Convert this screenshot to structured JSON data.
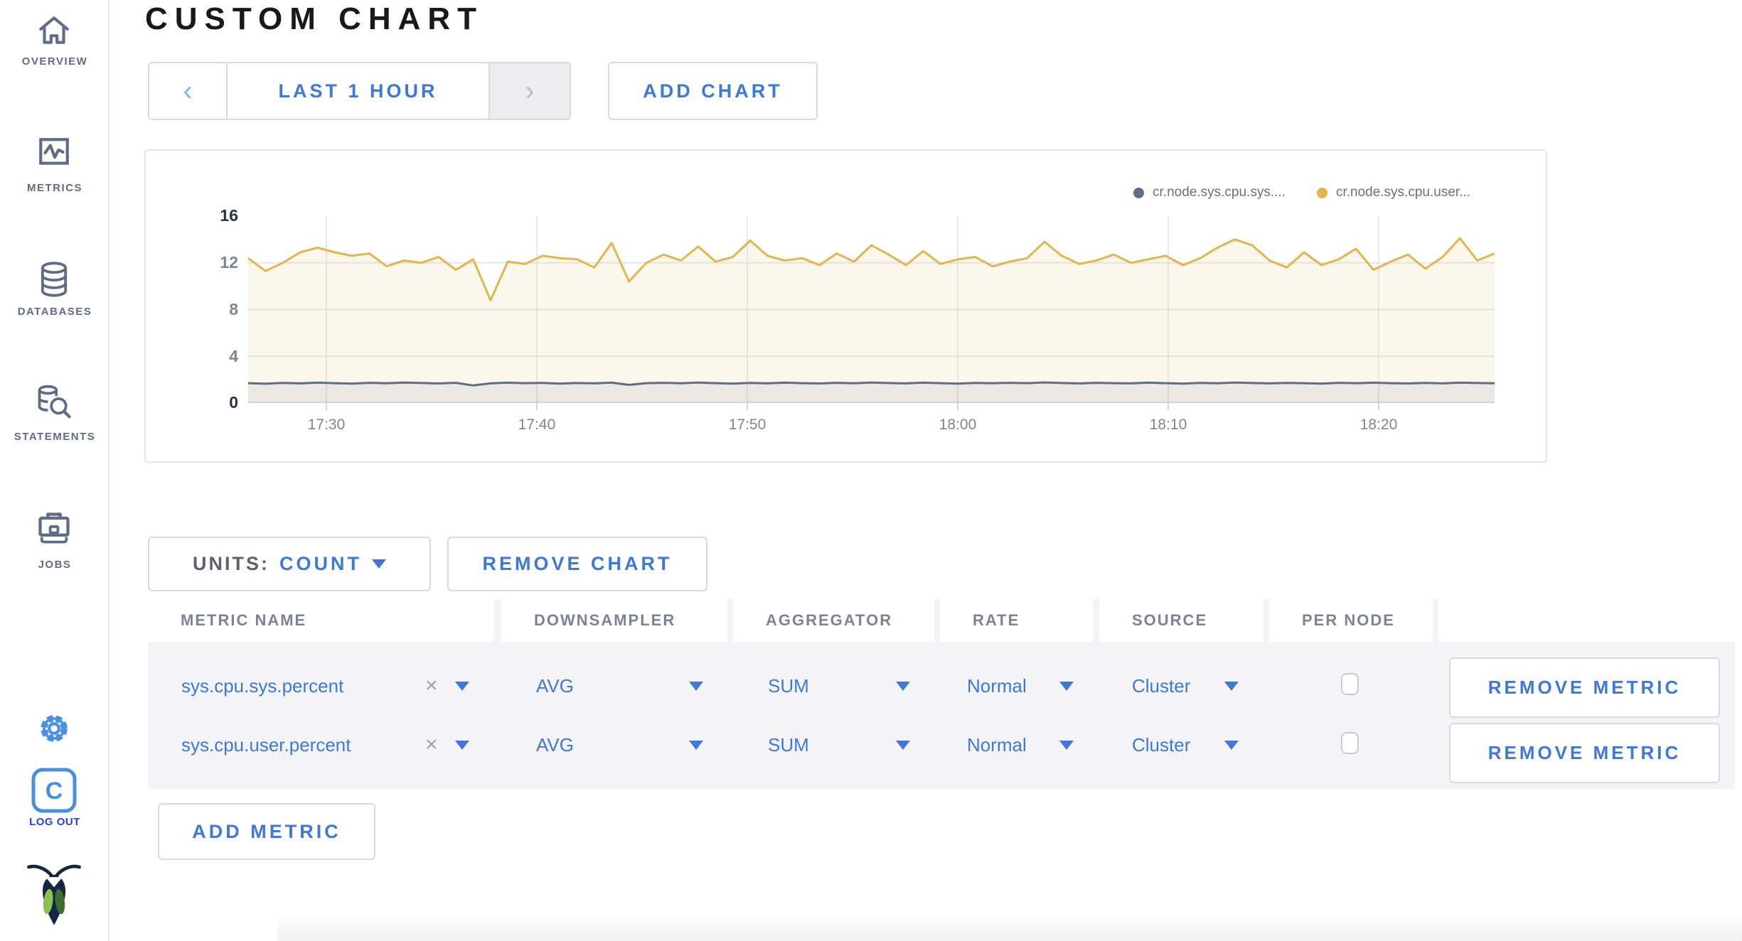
{
  "sidebar": {
    "items": [
      {
        "label": "OVERVIEW",
        "icon": "home-icon"
      },
      {
        "label": "METRICS",
        "icon": "metrics-icon"
      },
      {
        "label": "DATABASES",
        "icon": "database-icon"
      },
      {
        "label": "STATEMENTS",
        "icon": "statements-icon"
      },
      {
        "label": "JOBS",
        "icon": "briefcase-icon"
      }
    ],
    "settings_icon": "gear-icon",
    "log_out": {
      "label": "LOG OUT",
      "icon_letter": "C"
    },
    "logo_icon": "cockroachdb-logo"
  },
  "header": {
    "title": "CUSTOM CHART"
  },
  "toolbar": {
    "prev_icon": "‹",
    "time_range_label": "LAST 1 HOUR",
    "next_icon": "›",
    "add_chart_label": "ADD CHART"
  },
  "chart_card": {
    "legend": [
      {
        "label": "cr.node.sys.cpu.sys....",
        "color": "#5f6c87"
      },
      {
        "label": "cr.node.sys.cpu.user...",
        "color": "#e3b54d"
      }
    ]
  },
  "chart_data": {
    "type": "area",
    "title": "",
    "xlabel": "",
    "ylabel": "",
    "grid": true,
    "legend_position": "top-right",
    "ylim": [
      0,
      16
    ],
    "y_ticks": [
      0,
      4,
      8,
      12,
      16
    ],
    "x_ticks": [
      "17:30",
      "17:40",
      "17:50",
      "18:00",
      "18:10",
      "18:20"
    ],
    "series": [
      {
        "name": "cr.node.sys.cpu.sys....",
        "color": "#5f6c87",
        "fill": "rgba(95,108,135,0.10)",
        "values": [
          1.7,
          1.65,
          1.72,
          1.68,
          1.74,
          1.7,
          1.66,
          1.73,
          1.69,
          1.75,
          1.71,
          1.67,
          1.73,
          1.5,
          1.68,
          1.74,
          1.7,
          1.72,
          1.66,
          1.71,
          1.68,
          1.74,
          1.55,
          1.7,
          1.73,
          1.69,
          1.75,
          1.7,
          1.66,
          1.72,
          1.68,
          1.74,
          1.7,
          1.67,
          1.73,
          1.69,
          1.75,
          1.71,
          1.68,
          1.74,
          1.7,
          1.66,
          1.72,
          1.69,
          1.73,
          1.7,
          1.76,
          1.71,
          1.67,
          1.73,
          1.7,
          1.68,
          1.74,
          1.7,
          1.66,
          1.72,
          1.69,
          1.75,
          1.71,
          1.68,
          1.72,
          1.7,
          1.66,
          1.73,
          1.69,
          1.74,
          1.7,
          1.67,
          1.72,
          1.68,
          1.74,
          1.71,
          1.69
        ]
      },
      {
        "name": "cr.node.sys.cpu.user...",
        "color": "#e3b54d",
        "fill": "rgba(227,181,77,0.10)",
        "values": [
          12.4,
          11.3,
          12.0,
          12.9,
          13.3,
          12.9,
          12.6,
          12.8,
          11.7,
          12.2,
          12.0,
          12.5,
          11.4,
          12.3,
          8.8,
          12.1,
          11.9,
          12.6,
          12.4,
          12.3,
          11.6,
          13.7,
          10.4,
          12.0,
          12.7,
          12.2,
          13.4,
          12.1,
          12.5,
          13.9,
          12.6,
          12.2,
          12.4,
          11.8,
          12.8,
          12.1,
          13.5,
          12.7,
          11.8,
          13.0,
          11.9,
          12.3,
          12.5,
          11.7,
          12.1,
          12.4,
          13.8,
          12.6,
          11.9,
          12.2,
          12.7,
          12.0,
          12.3,
          12.6,
          11.8,
          12.4,
          13.3,
          14.0,
          13.5,
          12.2,
          11.6,
          12.9,
          11.8,
          12.3,
          13.2,
          11.4,
          12.1,
          12.7,
          11.5,
          12.5,
          14.1,
          12.2,
          12.8
        ]
      }
    ]
  },
  "chart_controls": {
    "units_label": "UNITS:",
    "units_value": "COUNT",
    "remove_chart_label": "REMOVE CHART"
  },
  "table": {
    "columns": [
      "METRIC NAME",
      "DOWNSAMPLER",
      "AGGREGATOR",
      "RATE",
      "SOURCE",
      "PER NODE",
      ""
    ],
    "clear_icon": "×",
    "rows": [
      {
        "metric_name": "sys.cpu.sys.percent",
        "downsampler": "AVG",
        "aggregator": "SUM",
        "rate": "Normal",
        "source": "Cluster",
        "per_node_checked": false,
        "remove_label": "REMOVE METRIC"
      },
      {
        "metric_name": "sys.cpu.user.percent",
        "downsampler": "AVG",
        "aggregator": "SUM",
        "rate": "Normal",
        "source": "Cluster",
        "per_node_checked": false,
        "remove_label": "REMOVE METRIC"
      }
    ],
    "add_metric_label": "ADD METRIC"
  },
  "colors": {
    "accent_blue": "#3e78d8",
    "logout_blue": "#2743e3",
    "slate": "#5f6c87",
    "line_yellow": "#e3b54d"
  }
}
